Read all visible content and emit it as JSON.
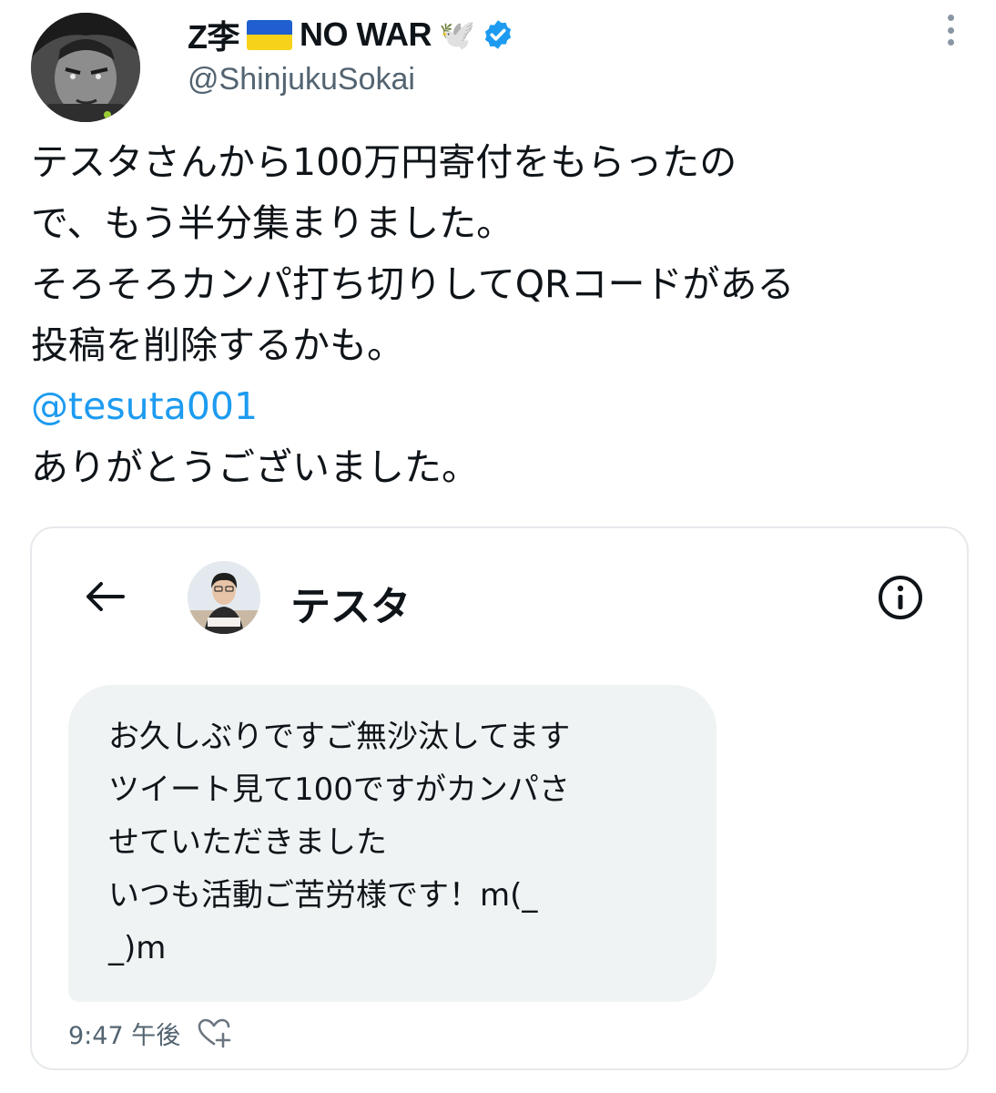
{
  "tweet": {
    "author": {
      "name": "Z李",
      "name_suffix": "NO WAR",
      "handle": "@ShinjukuSokai",
      "verified": true,
      "dove_glyph": "🕊️"
    },
    "text_lines": [
      "テスタさんから100万円寄付をもらったの",
      "で、もう半分集まりました。",
      "そろそろカンパ打ち切りしてQRコードがある",
      "投稿を削除するかも。"
    ],
    "mention": "@tesuta001",
    "closing": "ありがとうございました。"
  },
  "dm_screenshot": {
    "contact_name": "テスタ",
    "message_lines": [
      "お久しぶりですご無沙汰してます",
      "ツイート見て100ですがカンパさ",
      "せていただきました",
      "いつも活動ご苦労様です！m(_",
      "_)m"
    ],
    "timestamp": "9:47 午後"
  },
  "icons": {
    "more": "more-vertical-icon",
    "verified": "verified-badge-icon",
    "back": "back-arrow-icon",
    "info": "info-icon",
    "react": "heart-plus-icon"
  },
  "colors": {
    "link": "#1d9bf0",
    "verified": "#1d9bf0",
    "muted": "#536471",
    "bubble": "#eff3f4",
    "ukraine_blue": "#1f5fcf",
    "ukraine_yellow": "#f7d21b"
  }
}
